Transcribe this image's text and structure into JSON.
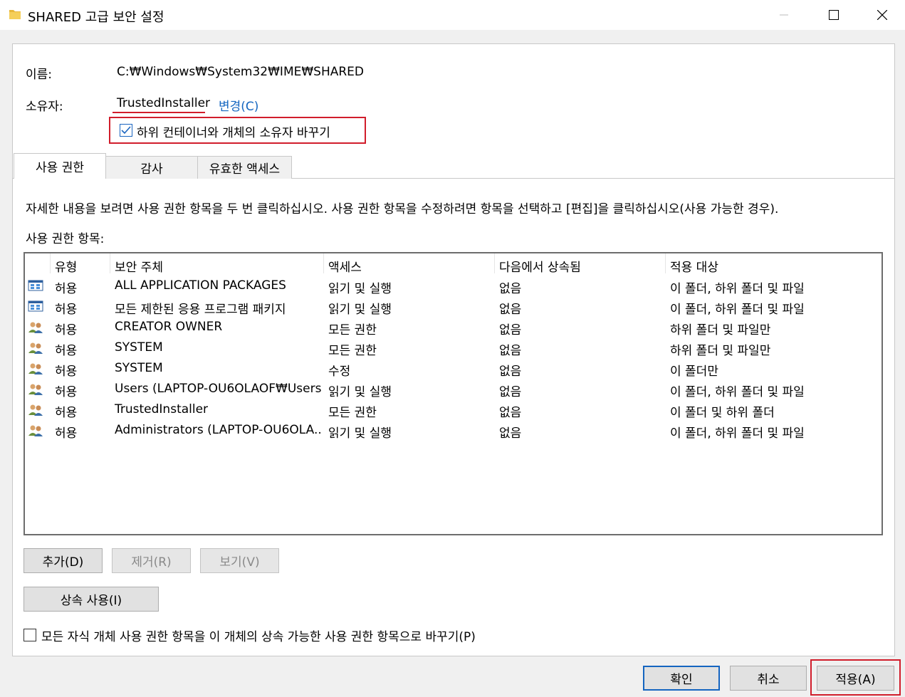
{
  "window": {
    "title": "SHARED 고급 보안 설정",
    "minimize_glyph": "—",
    "maximize_glyph": "☐",
    "close_glyph": "✕"
  },
  "name": {
    "label": "이름:",
    "value": "C:₩Windows₩System32₩IME₩SHARED"
  },
  "owner": {
    "label": "소유자:",
    "value": "TrustedInstaller",
    "change_link": "변경(C)"
  },
  "replace_owner_checkbox": {
    "label": "하위 컨테이너와 개체의 소유자 바꾸기",
    "checked": true
  },
  "tabs": [
    {
      "label": "사용 권한",
      "active": true
    },
    {
      "label": "감사",
      "active": false
    },
    {
      "label": "유효한 액세스",
      "active": false
    }
  ],
  "instructions": "자세한 내용을 보려면 사용 권한 항목을 두 번 클릭하십시오. 사용 권한 항목을 수정하려면 항목을 선택하고 [편집]을 클릭하십시오(사용 가능한 경우).",
  "entries_label": "사용 권한 항목:",
  "columns": [
    "유형",
    "보안 주체",
    "액세스",
    "다음에서 상속됨",
    "적용 대상"
  ],
  "rows": [
    {
      "icon": "app-packages-icon",
      "type": "허용",
      "principal": "ALL APPLICATION PACKAGES",
      "access": "읽기 및 실행",
      "inherited": "없음",
      "applies": "이 폴더, 하위 폴더 및 파일"
    },
    {
      "icon": "app-packages-icon",
      "type": "허용",
      "principal": "모든 제한된 응용 프로그램 패키지",
      "access": "읽기 및 실행",
      "inherited": "없음",
      "applies": "이 폴더, 하위 폴더 및 파일"
    },
    {
      "icon": "users-icon",
      "type": "허용",
      "principal": "CREATOR OWNER",
      "access": "모든 권한",
      "inherited": "없음",
      "applies": "하위 폴더 및 파일만"
    },
    {
      "icon": "users-icon",
      "type": "허용",
      "principal": "SYSTEM",
      "access": "모든 권한",
      "inherited": "없음",
      "applies": "하위 폴더 및 파일만"
    },
    {
      "icon": "users-icon",
      "type": "허용",
      "principal": "SYSTEM",
      "access": "수정",
      "inherited": "없음",
      "applies": "이 폴더만"
    },
    {
      "icon": "users-icon",
      "type": "허용",
      "principal": "Users (LAPTOP-OU6OLAOF₩Users)",
      "access": "읽기 및 실행",
      "inherited": "없음",
      "applies": "이 폴더, 하위 폴더 및 파일"
    },
    {
      "icon": "users-icon",
      "type": "허용",
      "principal": "TrustedInstaller",
      "access": "모든 권한",
      "inherited": "없음",
      "applies": "이 폴더 및 하위 폴더"
    },
    {
      "icon": "users-icon",
      "type": "허용",
      "principal": "Administrators (LAPTOP-OU6OLA...",
      "access": "읽기 및 실행",
      "inherited": "없음",
      "applies": "이 폴더, 하위 폴더 및 파일"
    }
  ],
  "buttons": {
    "add": "추가(D)",
    "remove": "제거(R)",
    "view": "보기(V)",
    "inherit": "상속 사용(I)",
    "ok": "확인",
    "cancel": "취소",
    "apply": "적용(A)"
  },
  "replace_child_checkbox": {
    "label": "모든 자식 개체 사용 권한 항목을 이 개체의 상속 가능한 사용 권한 항목으로 바꾸기(P)",
    "checked": false
  },
  "colors": {
    "highlight": "#d11d2b",
    "link": "#1466c0",
    "accent": "#1565c0"
  }
}
